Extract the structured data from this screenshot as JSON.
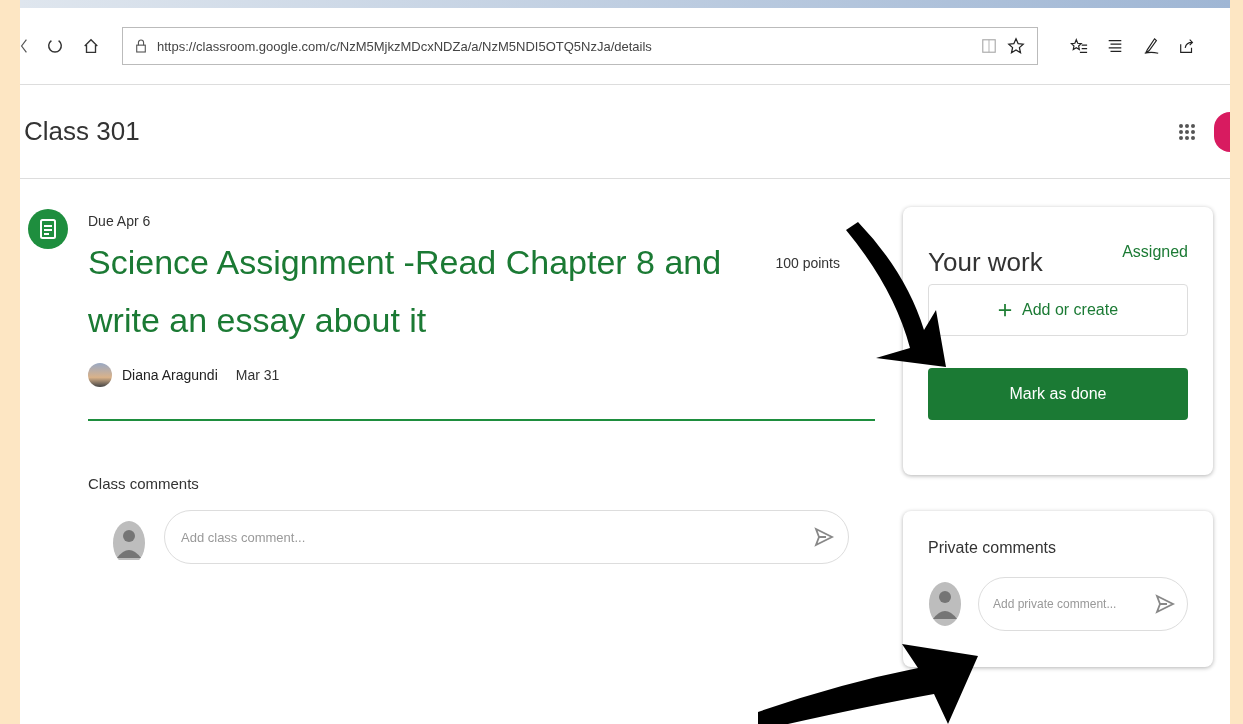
{
  "browser": {
    "url": "https://classroom.google.com/c/NzM5MjkzMDcxNDZa/a/NzM5NDI5OTQ5NzJa/details"
  },
  "header": {
    "title": "Class 301"
  },
  "assignment": {
    "due": "Due Apr 6",
    "title": "Science Assignment -Read Chapter 8 and write an essay about it",
    "points": "100 points",
    "author": "Diana Aragundi",
    "date": "Mar 31"
  },
  "class_comments": {
    "label": "Class comments",
    "placeholder": "Add class comment..."
  },
  "your_work": {
    "title": "Your work",
    "status": "Assigned",
    "add_button": "Add or create",
    "done_button": "Mark as done"
  },
  "private_comments": {
    "label": "Private comments",
    "placeholder": "Add private comment..."
  }
}
